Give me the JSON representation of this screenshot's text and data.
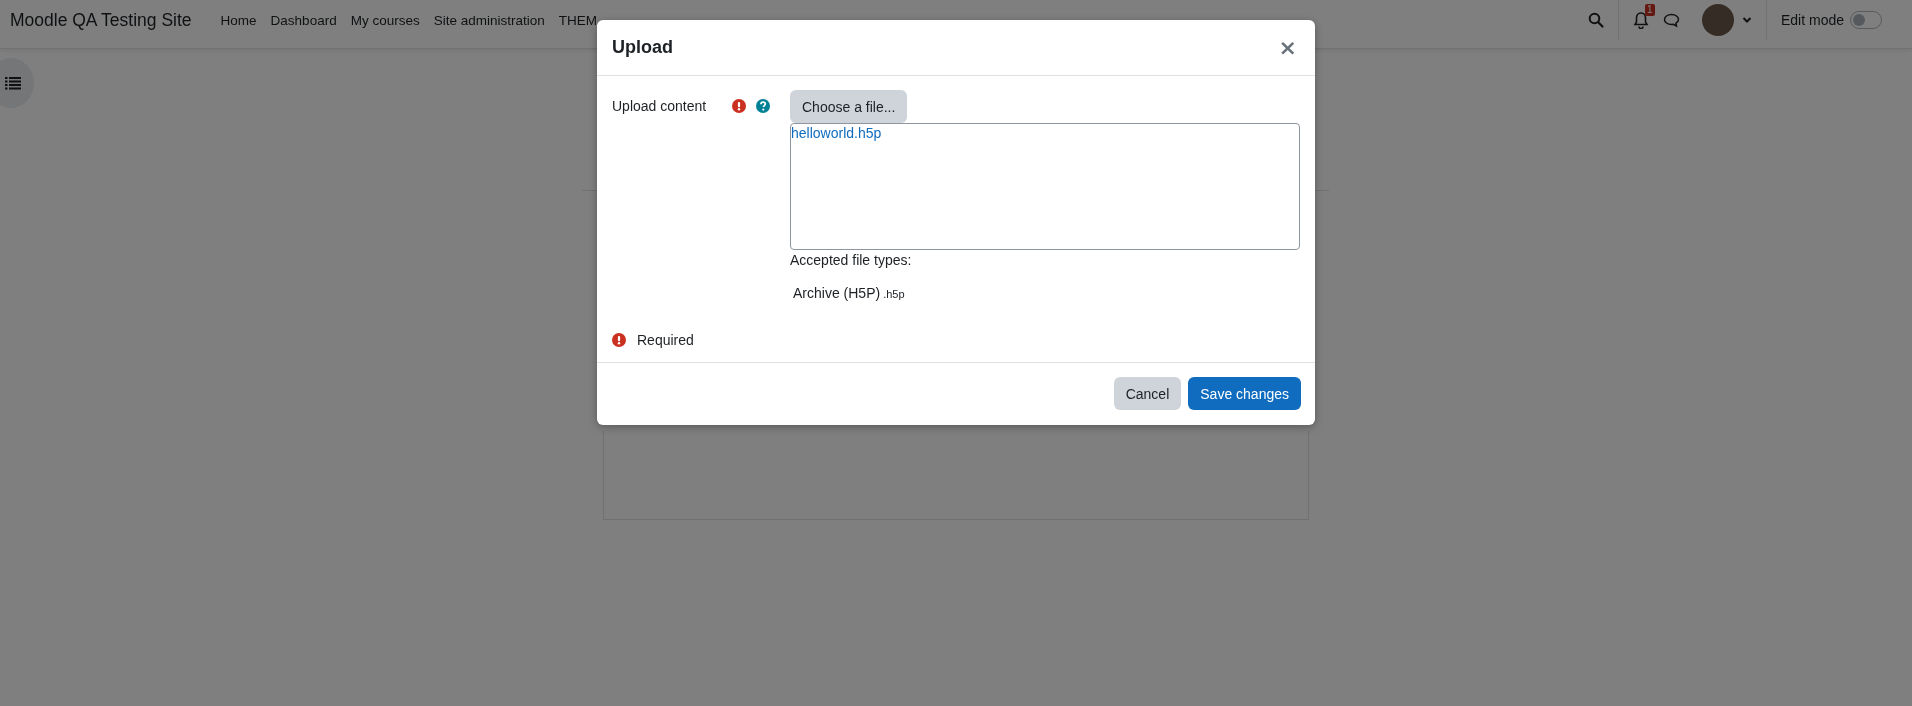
{
  "navbar": {
    "site_name": "Moodle QA Testing Site",
    "menu": [
      {
        "label": "Home"
      },
      {
        "label": "Dashboard"
      },
      {
        "label": "My courses"
      },
      {
        "label": "Site administration"
      },
      {
        "label": "THEM"
      }
    ],
    "notification_count": "1",
    "edit_mode": {
      "label": "Edit mode",
      "on": false
    }
  },
  "dialog": {
    "title": "Upload",
    "close": "×",
    "field": {
      "label": "Upload content",
      "required": true,
      "help": true,
      "button": "Choose a file...",
      "files": [
        "helloworld.h5p"
      ],
      "accepted_heading": "Accepted file types:",
      "accepted_types": [
        {
          "name": "Archive (H5P)",
          "extension": ".h5p"
        }
      ]
    },
    "required_note": "Required",
    "buttons": [
      {
        "label": "Cancel",
        "kind": "secondary"
      },
      {
        "label": "Save changes",
        "kind": "primary"
      }
    ]
  }
}
